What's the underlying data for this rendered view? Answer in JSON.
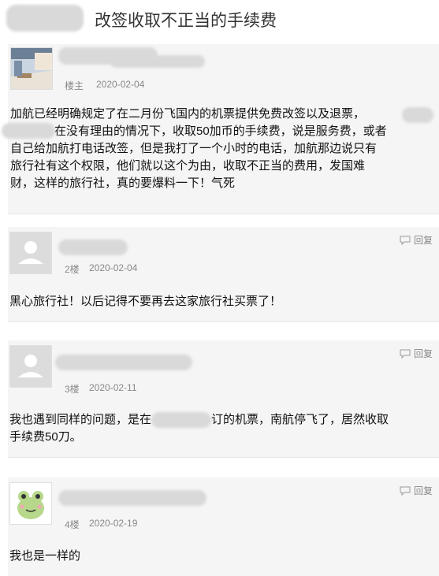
{
  "page": {
    "title": "改签收取不正当的手续费"
  },
  "main_post": {
    "floor": "楼主",
    "date": "2020-02-04",
    "content_lines": [
      "加航已经明确规定了在二月份飞国内的机票提供免费改签以及退票，",
      "在没有理由的情况下，收取50加币的手续费，说是服务费，或者",
      "自己给加航打电话改签，但是我打了一个小时的电话，加航那边说只有",
      "旅行社有这个权限，他们就以这个为由，收取不正当的费用，发国难",
      "财，这样的旅行社，真的要爆料一下！气死"
    ]
  },
  "replies": [
    {
      "floor": "2楼",
      "date": "2020-02-04",
      "reply_label": "回复",
      "content_lines": [
        "黑心旅行社！以后记得不要再去这家旅行社买票了！"
      ]
    },
    {
      "floor": "3楼",
      "date": "2020-02-11",
      "reply_label": "回复",
      "content_lines": [
        "我也遇到同样的问题，是在",
        "订的机票，南航停飞了，居然收取",
        "手续费50刀。"
      ]
    },
    {
      "floor": "4楼",
      "date": "2020-02-19",
      "reply_label": "回复",
      "content_lines": [
        "我也是一样的"
      ]
    }
  ],
  "icons": {
    "reply": "comment-icon",
    "avatar_default": "default-user-icon",
    "avatar_frog": "frog-sticker-icon"
  },
  "colors": {
    "meta_text": "#888888",
    "panel_bg": "#f5f5f5",
    "redaction": "#d9d9d9"
  }
}
